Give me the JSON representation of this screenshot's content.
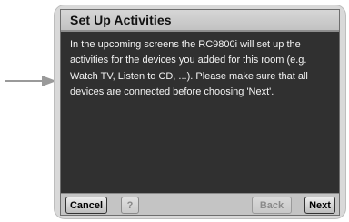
{
  "dialog": {
    "title": "Set Up Activities",
    "message": "In the upcoming screens the RC9800i will set up the activities for the devices you added for this room (e.g. Watch TV, Listen to CD, ...). Please make sure that all devices are connected before choosing 'Next'."
  },
  "buttons": {
    "cancel": "Cancel",
    "help": "?",
    "back": "Back",
    "next": "Next"
  },
  "states": {
    "back_enabled": false,
    "help_enabled": false
  },
  "colors": {
    "screen_bg": "#303030",
    "title_bar": "#c8c8c8",
    "text": "#f4f4f4"
  },
  "icons": {
    "pointer": "arrow-right-icon"
  }
}
